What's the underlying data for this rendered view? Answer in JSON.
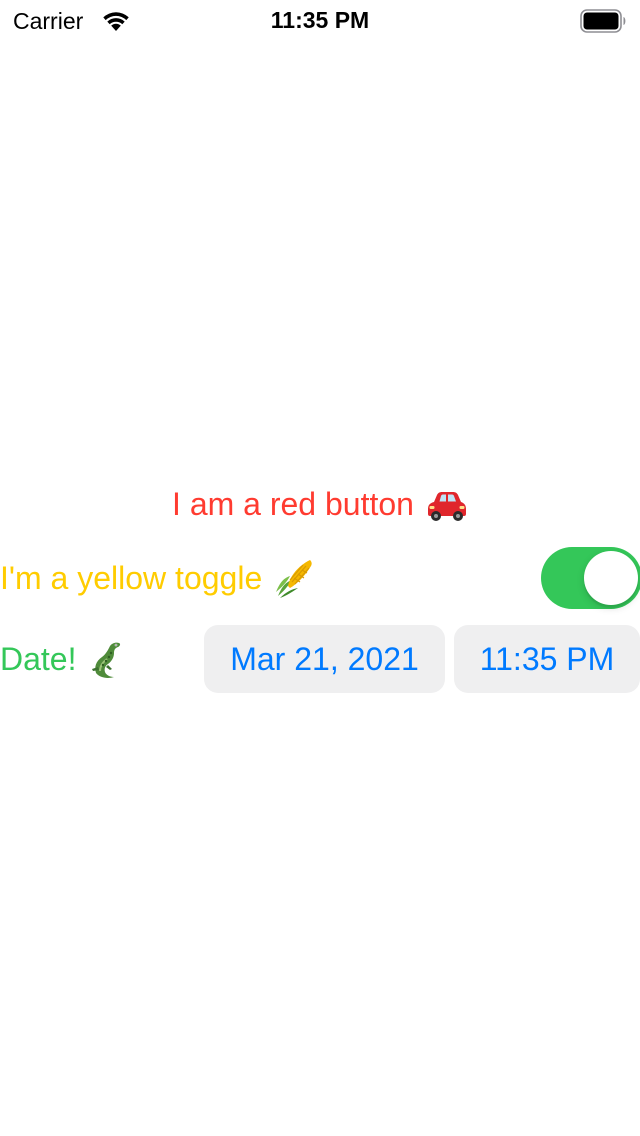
{
  "status_bar": {
    "carrier": "Carrier",
    "time": "11:35 PM",
    "wifi_icon": "wifi-icon",
    "battery_icon": "battery-full-icon"
  },
  "red_button": {
    "label": "I am a red button",
    "color": "#ff3b30",
    "emoji_icon": "red-car-icon"
  },
  "toggle": {
    "label": "I'm a yellow toggle",
    "color": "#ffcc00",
    "emoji_icon": "corn-icon",
    "is_on": true,
    "track_color": "#34c759"
  },
  "date_picker": {
    "label": "Date!",
    "color": "#34c759",
    "emoji_icon": "crocodile-icon",
    "date_value": "Mar 21, 2021",
    "time_value": "11:35 PM",
    "value_color": "#007aff",
    "pill_background": "#efeff0"
  }
}
